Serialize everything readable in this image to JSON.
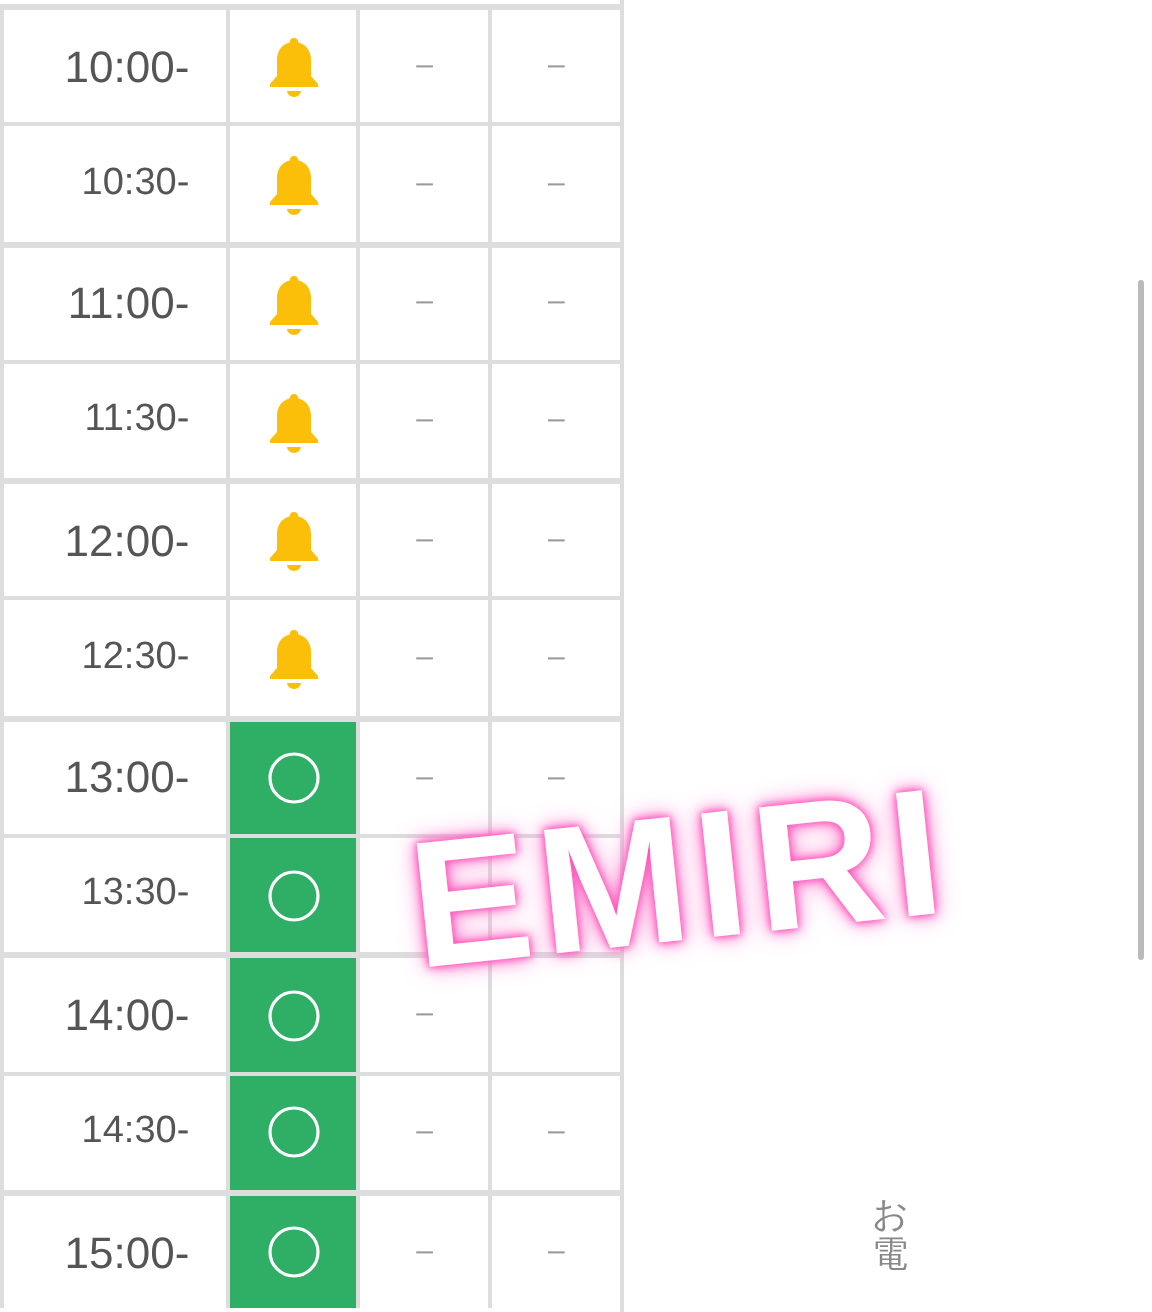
{
  "schedule": [
    {
      "time": "10:00-",
      "major": true,
      "cells": [
        {
          "kind": "bell"
        },
        {
          "kind": "dash",
          "text": "–"
        },
        {
          "kind": "dash",
          "text": "–"
        }
      ]
    },
    {
      "time": "10:30-",
      "major": false,
      "cells": [
        {
          "kind": "bell"
        },
        {
          "kind": "dash",
          "text": "–"
        },
        {
          "kind": "dash",
          "text": "–"
        }
      ]
    },
    {
      "time": "11:00-",
      "major": true,
      "cells": [
        {
          "kind": "bell"
        },
        {
          "kind": "dash",
          "text": "–"
        },
        {
          "kind": "dash",
          "text": "–"
        }
      ]
    },
    {
      "time": "11:30-",
      "major": false,
      "cells": [
        {
          "kind": "bell"
        },
        {
          "kind": "dash",
          "text": "–"
        },
        {
          "kind": "dash",
          "text": "–"
        }
      ]
    },
    {
      "time": "12:00-",
      "major": true,
      "cells": [
        {
          "kind": "bell"
        },
        {
          "kind": "dash",
          "text": "–"
        },
        {
          "kind": "dash",
          "text": "–"
        }
      ]
    },
    {
      "time": "12:30-",
      "major": false,
      "cells": [
        {
          "kind": "bell"
        },
        {
          "kind": "dash",
          "text": "–"
        },
        {
          "kind": "dash",
          "text": "–"
        }
      ]
    },
    {
      "time": "13:00-",
      "major": true,
      "cells": [
        {
          "kind": "open"
        },
        {
          "kind": "dash",
          "text": "–"
        },
        {
          "kind": "dash",
          "text": "–"
        }
      ]
    },
    {
      "time": "13:30-",
      "major": false,
      "cells": [
        {
          "kind": "open"
        },
        {
          "kind": "hidden"
        },
        {
          "kind": "hidden"
        }
      ]
    },
    {
      "time": "14:00-",
      "major": true,
      "cells": [
        {
          "kind": "open"
        },
        {
          "kind": "dash",
          "text": "–"
        },
        {
          "kind": "hidden"
        }
      ]
    },
    {
      "time": "14:30-",
      "major": false,
      "cells": [
        {
          "kind": "open"
        },
        {
          "kind": "dash",
          "text": "–"
        },
        {
          "kind": "dash",
          "text": "–"
        }
      ]
    },
    {
      "time": "15:00-",
      "major": true,
      "cells": [
        {
          "kind": "open"
        },
        {
          "kind": "dash",
          "text": "–"
        },
        {
          "kind": "dash",
          "text": "–"
        }
      ]
    }
  ],
  "sticker": "EMIRI",
  "side_text": "お電"
}
